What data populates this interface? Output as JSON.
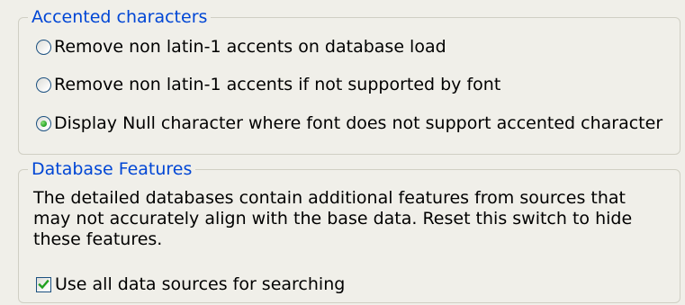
{
  "accented": {
    "title": "Accented characters",
    "options": [
      {
        "label": "Remove non latin-1 accents on database load",
        "selected": false
      },
      {
        "label": "Remove non latin-1 accents if not supported by font",
        "selected": false
      },
      {
        "label": "Display Null character where font does not support accented character",
        "selected": true
      }
    ]
  },
  "features": {
    "title": "Database Features",
    "description": "The detailed databases contain additional features from sources that may not accurately align with the base data. Reset this switch to hide these features.",
    "checkbox_label": "Use all data sources for searching",
    "checked": true
  },
  "colors": {
    "legend_text": "#0046d5",
    "radio_selected": "#21a121",
    "checkmark": "#21a121"
  }
}
